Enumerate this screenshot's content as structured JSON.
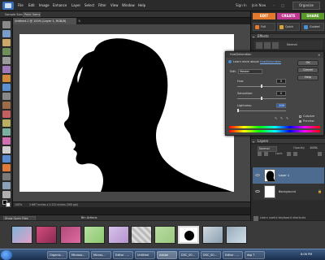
{
  "menubar": {
    "items": [
      "File",
      "Edit",
      "Image",
      "Enhance",
      "Layer",
      "Select",
      "Filter",
      "View",
      "Window",
      "Help"
    ],
    "account": [
      "Sign In",
      "Join Now"
    ],
    "organize_label": "Organize"
  },
  "options_bar": {
    "left_label": "Sample Size:",
    "left_value": "Point Sample"
  },
  "document": {
    "tab_title": "Untitled-1 @ 100% (Layer 1, RGB/8)",
    "status_zoom": "100%",
    "status_info": "2.667 inches x 2.222 inches (300 ppi)"
  },
  "right_panel": {
    "tabs": [
      {
        "label": "EDIT",
        "color": "#e4782c"
      },
      {
        "label": "CREATE",
        "color": "#c2378f"
      },
      {
        "label": "SHARE",
        "color": "#5a9a2a"
      }
    ],
    "modes": [
      {
        "label": "Full",
        "color": "#e4782c"
      },
      {
        "label": "Quick",
        "color": "#d9a23a"
      },
      {
        "label": "Guided",
        "color": "#4a90d0"
      }
    ],
    "effects_header": "Effects",
    "effects_row_label": "Normal",
    "layers_header": "Layers",
    "layers_blend": "Normal",
    "layers_opacity_label": "Opacity:",
    "layers_opacity": "100%",
    "layers_lock_label": "Lock:",
    "layers": [
      {
        "name": "Layer 1"
      },
      {
        "name": "Background"
      }
    ]
  },
  "dialog": {
    "title": "Hue/Saturation",
    "learn_more": "Learn more about:",
    "learn_link": "Hue/Saturation",
    "edit_label": "Edit:",
    "edit_value": "Master",
    "hue_label": "Hue:",
    "hue_value": "0",
    "saturation_label": "Saturation:",
    "saturation_value": "0",
    "lightness_label": "Lightness:",
    "lightness_value": "-100",
    "ok_label": "OK",
    "cancel_label": "Cancel",
    "help_label": "Help",
    "colorize_label": "Colorize",
    "preview_label": "Preview"
  },
  "bottom": {
    "project_bin_label": "Show Open Files",
    "bin_actions_label": "Bin Actions",
    "shortcut_label": "Learn useful keyboard shortcuts"
  },
  "taskbar": {
    "tasks": [
      "Organiz...",
      "Microso...",
      "Micros...",
      "Editor - ...",
      "Untitled",
      "Adobe",
      "DSC_00...",
      "DSC_00...",
      "Editor - ...",
      "dsp ?"
    ],
    "clock": "8:06 PM"
  }
}
